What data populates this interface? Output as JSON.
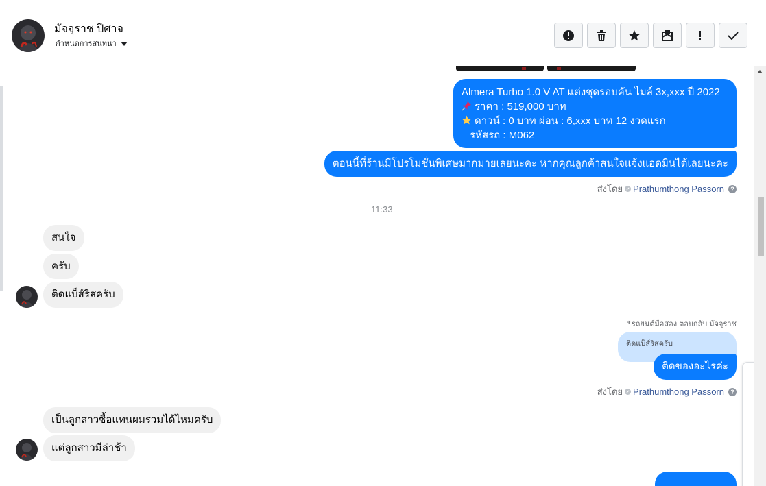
{
  "header": {
    "contact_name": "มัจจุราช ปีศาจ",
    "assign_label": "กำหนดการสนทนา",
    "actions": [
      {
        "icon": "alert-circle-icon",
        "label": "!"
      },
      {
        "icon": "trash-icon",
        "label": ""
      },
      {
        "icon": "star-icon",
        "label": ""
      },
      {
        "icon": "mark-unread-icon",
        "label": ""
      },
      {
        "icon": "exclamation-icon",
        "label": "!"
      },
      {
        "icon": "checkmark-icon",
        "label": ""
      }
    ]
  },
  "messages": {
    "car_offer": {
      "line1": "Almera Turbo 1.0 V AT แต่งชุดรอบคัน ไมล์ 3x,xxx ปี 2022",
      "line2": "ราคา : 519,000 บาท",
      "line3": "ดาวน์ : 0 บาท ผ่อน : 6,xxx บาท 12 งวดแรก",
      "line4": "รหัสรถ : M062"
    },
    "promo": "ตอนนี้ที่ร้านมีโปรโมชั่นพิเศษมากมายเลยนะคะ หากคุณลูกค้าสนใจแจ้งแอดมินได้เลยนะคะ",
    "sent_by_label": "ส่งโดย",
    "sent_by_name": "Prathumthong Passorn",
    "timestamp": "11:33",
    "incoming_1": "สนใจ",
    "incoming_2": "ครับ",
    "incoming_3": "ติดแบ็ส์ริสครับ",
    "reply_hint": "รถยนต์มือสอง ตอบกลับ มัจจุราช",
    "reply_quote": "ติดแบ็ส์ริสครับ",
    "outgoing_reply": "ติดของอะไรค่ะ",
    "incoming_4": "เป็นลูกสาวซื้อแทนผมรวมได้ไหมครับ",
    "incoming_5": "แต่ลูกสาวมีล่าช้า"
  },
  "colors": {
    "outgoing_bubble": "#0a7cff",
    "incoming_bubble": "#f0f0f0",
    "reply_quote_bg": "#cce4ff",
    "sender_link": "#385898"
  }
}
